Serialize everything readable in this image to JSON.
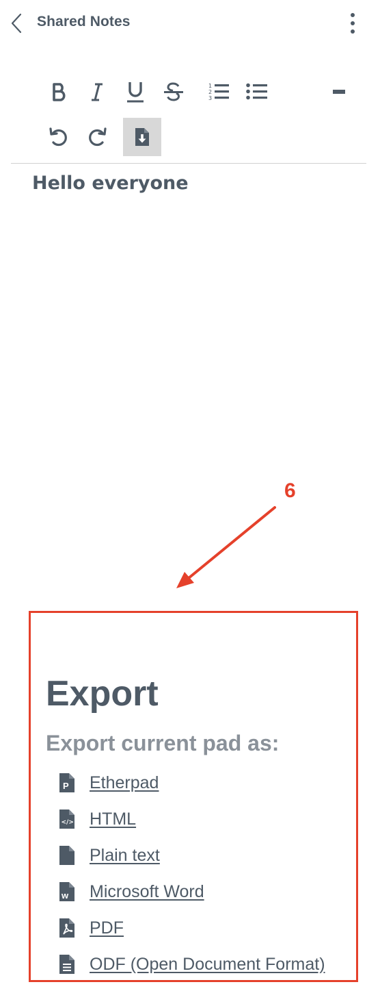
{
  "header": {
    "title": "Shared Notes"
  },
  "toolbar": {
    "bold_icon": "bold-icon",
    "italic_icon": "italic-icon",
    "underline_icon": "underline-icon",
    "strikethrough_icon": "strikethrough-icon",
    "ordered_list_icon": "ordered-list-icon",
    "unordered_list_icon": "unordered-list-icon",
    "minimize_icon": "minimize-icon",
    "undo_icon": "undo-icon",
    "redo_icon": "redo-icon",
    "export_icon": "file-export-icon",
    "active_color": "#d8d8d8"
  },
  "pad": {
    "text": "Hello everyone"
  },
  "annotation": {
    "step": "6",
    "color": "#e5412b"
  },
  "export": {
    "title": "Export",
    "subtitle": "Export current pad as:",
    "items": [
      {
        "label": "Etherpad",
        "icon": "etherpad-file-icon"
      },
      {
        "label": "HTML",
        "icon": "html-file-icon"
      },
      {
        "label": "Plain text",
        "icon": "text-file-icon"
      },
      {
        "label": "Microsoft Word",
        "icon": "word-file-icon"
      },
      {
        "label": "PDF",
        "icon": "pdf-file-icon"
      },
      {
        "label": "ODF (Open Document Format)",
        "icon": "odf-file-icon"
      }
    ]
  }
}
